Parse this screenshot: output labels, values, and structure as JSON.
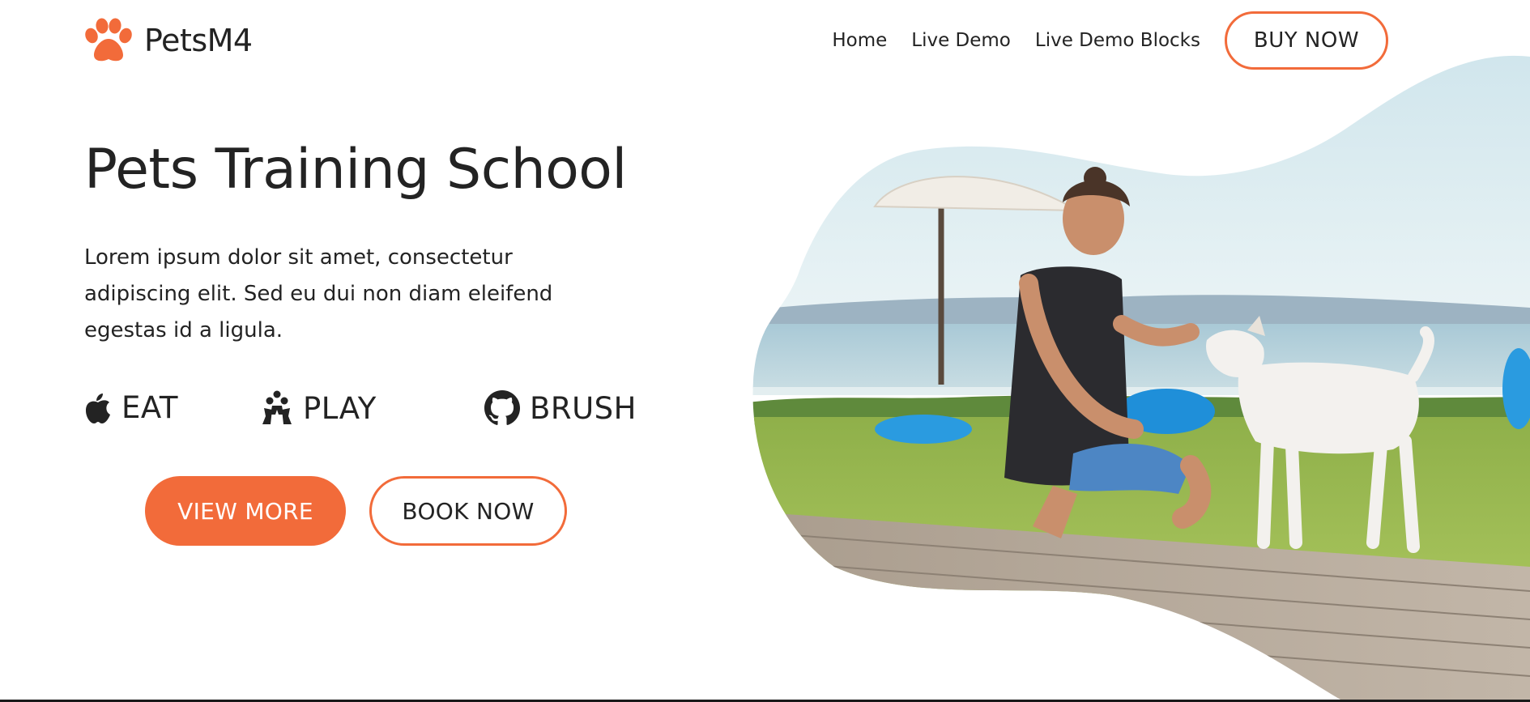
{
  "header": {
    "brand_name": "PetsM4",
    "logo_icon": "paw-icon",
    "nav": [
      {
        "label": "Home"
      },
      {
        "label": "Live Demo"
      },
      {
        "label": "Live Demo Blocks"
      }
    ],
    "buy_button": "BUY NOW"
  },
  "hero": {
    "title": "Pets Training School",
    "text": "Lorem ipsum dolor sit amet, consectetur adipiscing elit. Sed eu dui non diam eleifend egestas id a ligula.",
    "features": [
      {
        "icon": "apple-icon",
        "label": "EAT"
      },
      {
        "icon": "play-people-icon",
        "label": "PLAY"
      },
      {
        "icon": "github-icon",
        "label": "BRUSH"
      }
    ],
    "buttons": {
      "view_more": "VIEW MORE",
      "book_now": "BOOK NOW"
    },
    "image_icon": "man-and-dog-photo"
  },
  "colors": {
    "accent": "#f26b3a",
    "text": "#232323",
    "background": "#ffffff"
  }
}
